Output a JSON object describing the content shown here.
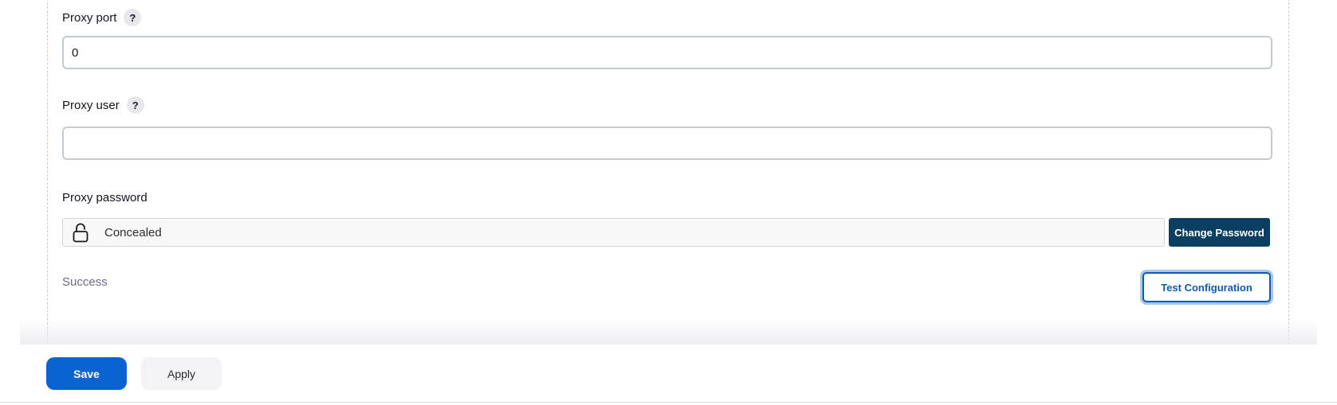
{
  "fields": {
    "proxy_port": {
      "label": "Proxy port",
      "help": "?",
      "value": "0"
    },
    "proxy_user": {
      "label": "Proxy user",
      "help": "?",
      "value": ""
    },
    "proxy_password": {
      "label": "Proxy password",
      "concealed_text": "Concealed",
      "change_button": "Change Password"
    }
  },
  "status": {
    "text": "Success"
  },
  "test_button": "Test Configuration",
  "footer": {
    "save_label": "Save",
    "apply_label": "Apply"
  },
  "colors": {
    "save_bg": "#0b63d1",
    "change_password_bg": "#0b3f62",
    "test_button_accent": "#0b5cad",
    "status_text": "#6b6b86"
  },
  "icons": {
    "help": "question-mark-icon",
    "password": "lock-icon"
  }
}
